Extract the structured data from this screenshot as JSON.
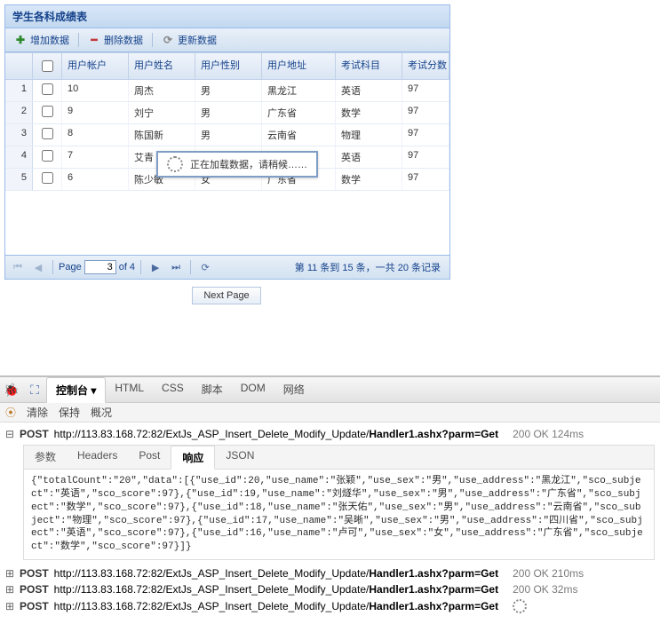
{
  "panel": {
    "title": "学生各科成绩表"
  },
  "toolbar": {
    "add_label": "增加数据",
    "del_label": "删除数据",
    "refresh_label": "更新数据"
  },
  "grid": {
    "headers": {
      "acct": "用户帐户",
      "name": "用户姓名",
      "sex": "用户性别",
      "addr": "用户地址",
      "subj": "考试科目",
      "score": "考试分数"
    },
    "rows": [
      {
        "num": "1",
        "acct": "10",
        "name": "周杰",
        "sex": "男",
        "addr": "黑龙江",
        "subj": "英语",
        "score": "97"
      },
      {
        "num": "2",
        "acct": "9",
        "name": "刘宁",
        "sex": "男",
        "addr": "广东省",
        "subj": "数学",
        "score": "97"
      },
      {
        "num": "3",
        "acct": "8",
        "name": "陈国新",
        "sex": "男",
        "addr": "云南省",
        "subj": "物理",
        "score": "97"
      },
      {
        "num": "4",
        "acct": "7",
        "name": "艾青",
        "sex": "",
        "addr": "",
        "subj": "英语",
        "score": "97"
      },
      {
        "num": "5",
        "acct": "6",
        "name": "陈少敏",
        "sex": "女",
        "addr": "广东省",
        "subj": "数学",
        "score": "97"
      }
    ]
  },
  "mask": {
    "text": "正在加载数据，请稍候……"
  },
  "pagebar": {
    "page_label": "Page",
    "page_value": "3",
    "of_label": "of 4",
    "status": "第 11 条到 15 条，一共 20 条记录"
  },
  "nextpage_label": "Next Page",
  "firebug": {
    "tabs": {
      "console": "控制台",
      "html": "HTML",
      "css": "CSS",
      "script": "脚本",
      "dom": "DOM",
      "net": "网络"
    },
    "subtabs": {
      "clear": "清除",
      "persist": "保持",
      "profile": "概况"
    },
    "req_url_prefix": "http://113.83.168.72:82/ExtJs_ASP_Insert_Delete_Modify_Update/",
    "req_url_bold": "Handler1.ashx?parm=Get",
    "requests": [
      {
        "method": "POST",
        "status": "200 OK 124ms",
        "expanded": true
      },
      {
        "method": "POST",
        "status": "200 OK 210ms",
        "expanded": false
      },
      {
        "method": "POST",
        "status": "200 OK 32ms",
        "expanded": false
      },
      {
        "method": "POST",
        "status": "",
        "expanded": false,
        "pending": true
      }
    ],
    "detail_tabs": {
      "params": "参数",
      "headers": "Headers",
      "post": "Post",
      "response": "响应",
      "json": "JSON"
    },
    "response_text": "{\"totalCount\":\"20\",\"data\":[{\"use_id\":20,\"use_name\":\"张颖\",\"use_sex\":\"男\",\"use_address\":\"黑龙江\",\"sco_subject\":\"英语\",\"sco_score\":97},{\"use_id\":19,\"use_name\":\"刘燧华\",\"use_sex\":\"男\",\"use_address\":\"广东省\",\"sco_subject\":\"数学\",\"sco_score\":97},{\"use_id\":18,\"use_name\":\"张天佑\",\"use_sex\":\"男\",\"use_address\":\"云南省\",\"sco_subject\":\"物理\",\"sco_score\":97},{\"use_id\":17,\"use_name\":\"吴晰\",\"use_sex\":\"男\",\"use_address\":\"四川省\",\"sco_subject\":\"英语\",\"sco_score\":97},{\"use_id\":16,\"use_name\":\"卢可\",\"use_sex\":\"女\",\"use_address\":\"广东省\",\"sco_subject\":\"数学\",\"sco_score\":97}]}"
  }
}
